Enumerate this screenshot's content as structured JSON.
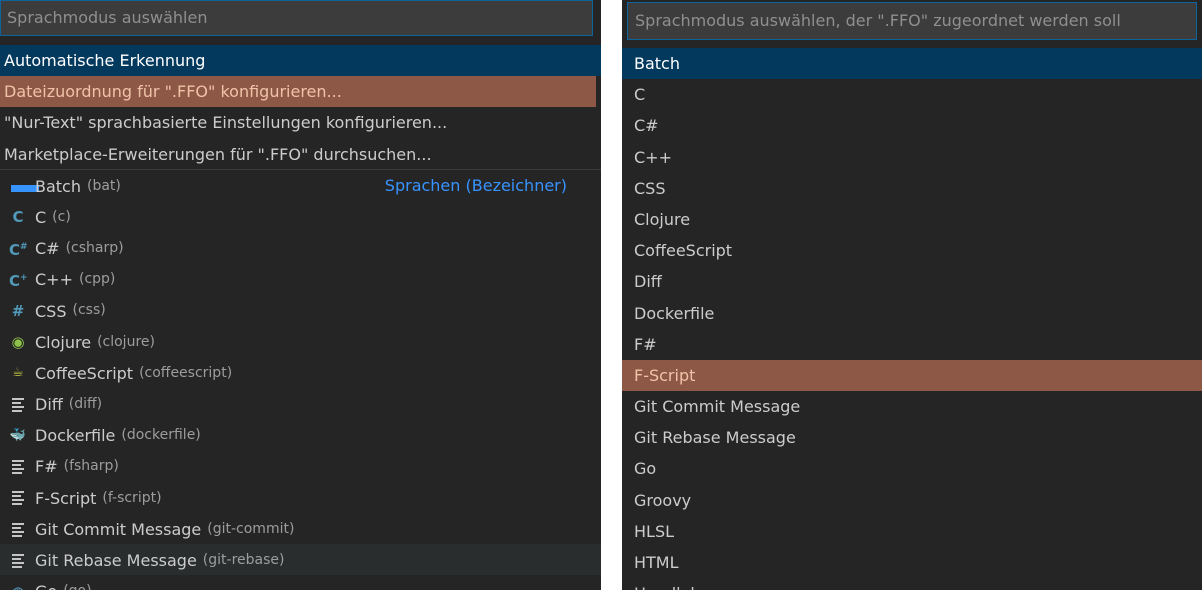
{
  "left": {
    "search_placeholder": "Sprachmodus auswählen",
    "actions": [
      {
        "label": "Automatische Erkennung"
      },
      {
        "label": "Dateizuordnung für \".FFO\" konfigurieren..."
      },
      {
        "label": "\"Nur-Text\" sprachbasierte Einstellungen konfigurieren..."
      },
      {
        "label": "Marketplace-Erweiterungen für \".FFO\" durchsuchen..."
      }
    ],
    "group_label": "Sprachen (Bezeichner)",
    "languages": [
      {
        "label": "Batch",
        "id": "(bat)",
        "icon": "windows-icon",
        "color": "#3794ff"
      },
      {
        "label": "C",
        "id": "(c)",
        "icon": "c-icon",
        "glyph": "C",
        "color": "#519aba"
      },
      {
        "label": "C#",
        "id": "(csharp)",
        "icon": "csharp-icon",
        "glyph": "C",
        "color": "#519aba"
      },
      {
        "label": "C++",
        "id": "(cpp)",
        "icon": "cpp-icon",
        "glyph": "C",
        "color": "#519aba"
      },
      {
        "label": "CSS",
        "id": "(css)",
        "icon": "css-icon",
        "glyph": "#",
        "color": "#519aba"
      },
      {
        "label": "Clojure",
        "id": "(clojure)",
        "icon": "clojure-icon",
        "glyph": "◉",
        "color": "#8dc149"
      },
      {
        "label": "CoffeeScript",
        "id": "(coffeescript)",
        "icon": "coffee-icon",
        "glyph": "☕",
        "color": "#cbcb41"
      },
      {
        "label": "Diff",
        "id": "(diff)",
        "icon": "lines-icon"
      },
      {
        "label": "Dockerfile",
        "id": "(dockerfile)",
        "icon": "docker-icon",
        "glyph": "🐳",
        "color": "#519aba"
      },
      {
        "label": "F#",
        "id": "(fsharp)",
        "icon": "lines-icon"
      },
      {
        "label": "F-Script",
        "id": "(f-script)",
        "icon": "lines-icon"
      },
      {
        "label": "Git Commit Message",
        "id": "(git-commit)",
        "icon": "lines-icon"
      },
      {
        "label": "Git Rebase Message",
        "id": "(git-rebase)",
        "icon": "lines-icon"
      },
      {
        "label": "Go",
        "id": "(go)",
        "icon": "go-icon",
        "glyph": "◍",
        "color": "#519aba"
      }
    ]
  },
  "right": {
    "search_placeholder": "Sprachmodus auswählen, der \".FFO\" zugeordnet werden soll",
    "languages": [
      "Batch",
      "C",
      "C#",
      "C++",
      "CSS",
      "Clojure",
      "CoffeeScript",
      "Diff",
      "Dockerfile",
      "F#",
      "F-Script",
      "Git Commit Message",
      "Git Rebase Message",
      "Go",
      "Groovy",
      "HLSL",
      "HTML",
      "Handlebars"
    ]
  }
}
